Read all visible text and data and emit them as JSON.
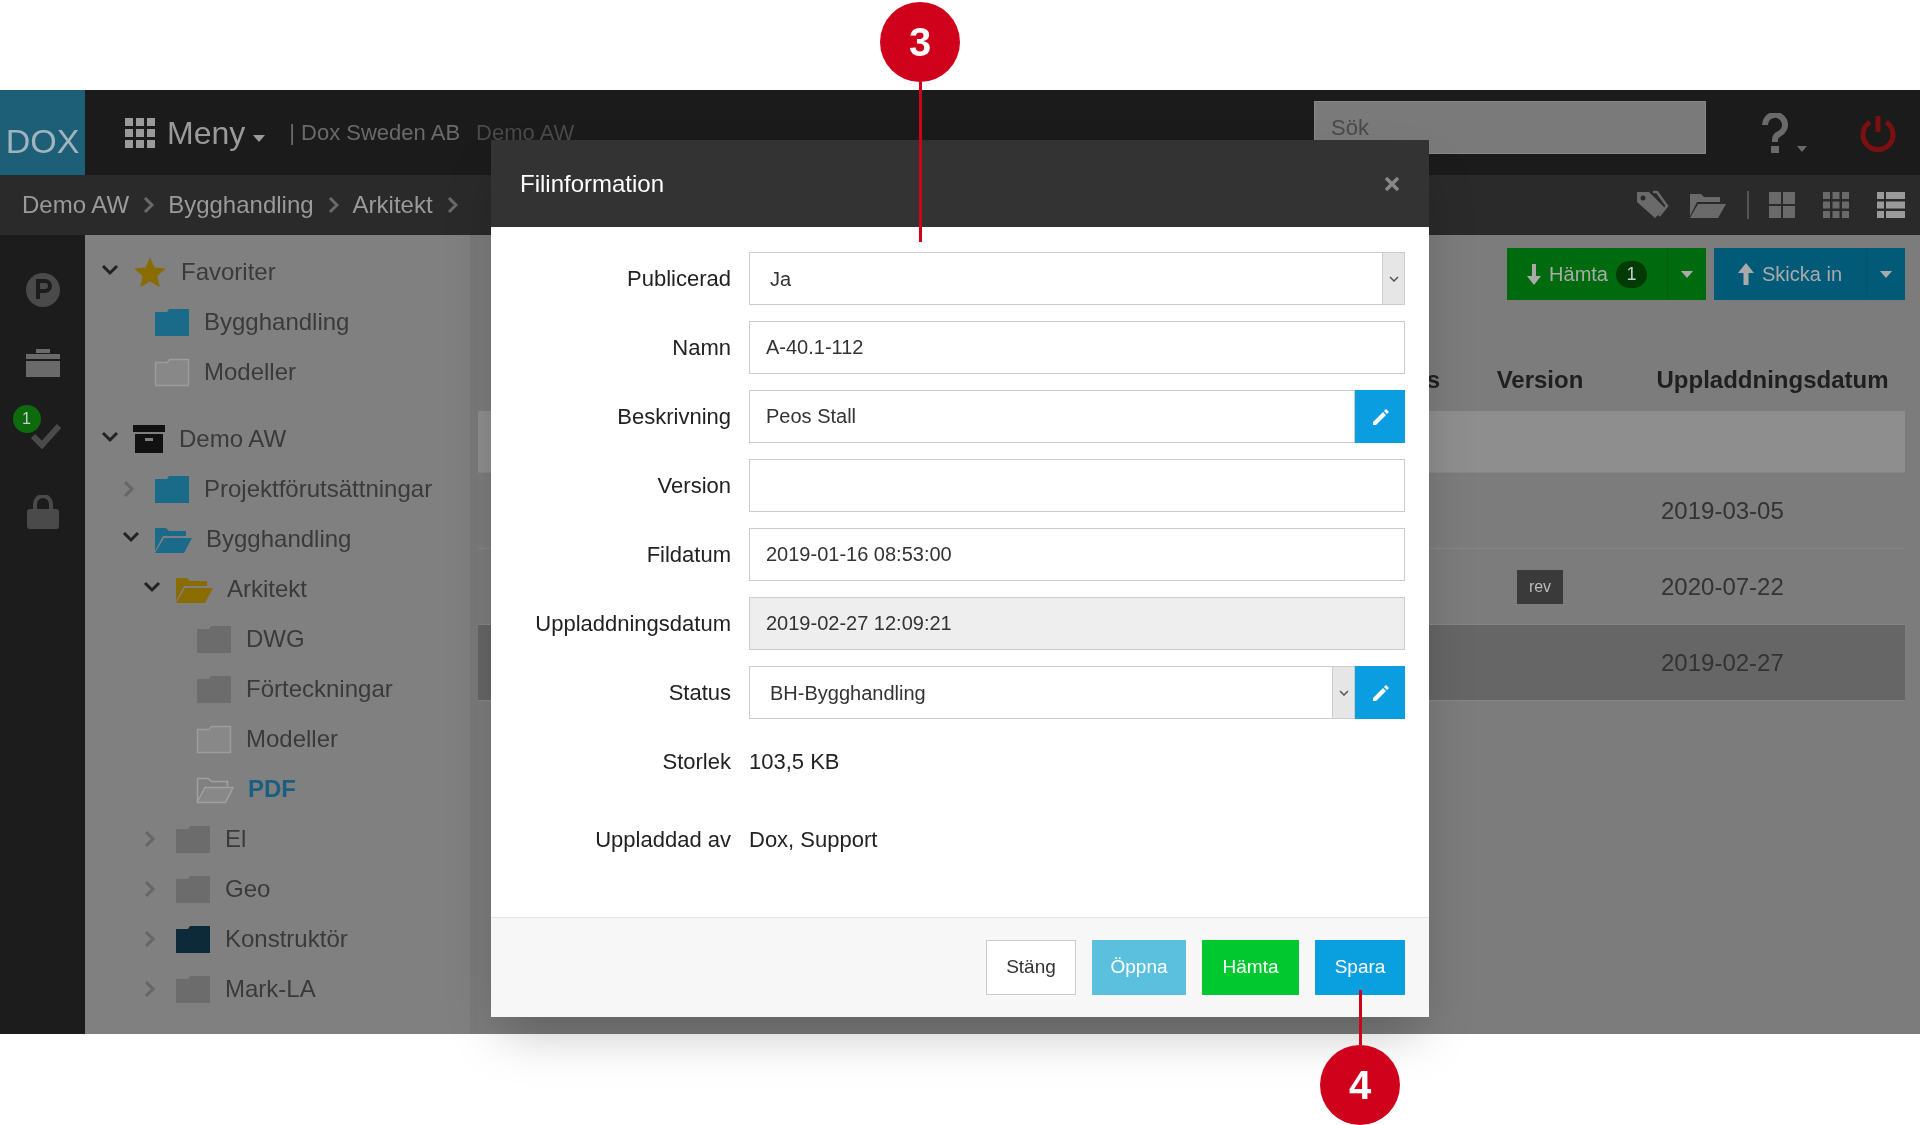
{
  "topbar": {
    "logo": "DOX",
    "menu": "Meny",
    "company": "| Dox Sweden AB",
    "project": "Demo AW",
    "search": {
      "placeholder": "Sök"
    }
  },
  "breadcrumb": [
    "Demo AW",
    "Bygghandling",
    "Arkitekt"
  ],
  "rail": {
    "badge": "1"
  },
  "tree": [
    {
      "label": "Favoriter",
      "kind": "star",
      "expanded": true,
      "selected": false,
      "children": [
        {
          "label": "Bygghandling",
          "kind": "folder",
          "color": "#1a6a8a",
          "selected": false
        },
        {
          "label": "Modeller",
          "kind": "empty",
          "selected": false
        }
      ]
    },
    {
      "label": "Demo AW",
      "kind": "archive",
      "expanded": true,
      "selected": false,
      "children": [
        {
          "label": "Projektförutsättningar",
          "kind": "folder",
          "color": "#1a6a8a",
          "expanded": false,
          "selected": false
        },
        {
          "label": "Bygghandling",
          "kind": "open",
          "color": "#1a6a8a",
          "expanded": true,
          "selected": false,
          "children": [
            {
              "label": "Arkitekt",
              "kind": "open",
              "color": "#8a6d00",
              "expanded": true,
              "selected": false,
              "children": [
                {
                  "label": "DWG",
                  "kind": "folder",
                  "color": "#6c6c6c",
                  "selected": false
                },
                {
                  "label": "Förteckningar",
                  "kind": "folder",
                  "color": "#6c6c6c",
                  "selected": false
                },
                {
                  "label": "Modeller",
                  "kind": "empty",
                  "selected": false
                },
                {
                  "label": "PDF",
                  "kind": "emptyopen",
                  "selected": true
                }
              ]
            },
            {
              "label": "El",
              "kind": "folder",
              "color": "#6c6c6c",
              "expanded": false,
              "selected": false
            },
            {
              "label": "Geo",
              "kind": "folder",
              "color": "#6c6c6c",
              "expanded": false,
              "selected": false
            },
            {
              "label": "Konstruktör",
              "kind": "folder",
              "color": "#0d2a38",
              "expanded": false,
              "selected": false
            },
            {
              "label": "Mark-LA",
              "kind": "folder",
              "color": "#6c6c6c",
              "expanded": false,
              "selected": false
            }
          ]
        }
      ]
    }
  ],
  "toolbar": {
    "download": {
      "label": "Hämta",
      "count": "1"
    },
    "upload": {
      "label": "Skicka in"
    }
  },
  "table": {
    "columns": [
      "s",
      "Version",
      "Uppladdningsdatum"
    ],
    "rows": [
      {
        "hover": true,
        "selected": false
      },
      {
        "hover": false,
        "selected": false,
        "date": "2019-03-05"
      },
      {
        "hover": false,
        "selected": false,
        "badge": "rev",
        "date": "2020-07-22"
      },
      {
        "hover": false,
        "selected": true,
        "date": "2019-02-27"
      }
    ]
  },
  "dialog": {
    "title": "Filinformation",
    "fields": [
      {
        "label": "Publicerad",
        "kind": "select",
        "value": "Ja"
      },
      {
        "label": "Namn",
        "kind": "input",
        "value": "A-40.1-112"
      },
      {
        "label": "Beskrivning",
        "kind": "edit",
        "value": "Peos Stall"
      },
      {
        "label": "Version",
        "kind": "input"
      },
      {
        "label": "Fildatum",
        "kind": "input",
        "value": "2019-01-16 08:53:00"
      },
      {
        "label": "Uppladdningsdatum",
        "kind": "readonly",
        "value": "2019-02-27 12:09:21"
      },
      {
        "label": "Status",
        "kind": "selectedit",
        "value": "BH-Bygghandling"
      },
      {
        "label": "Storlek",
        "kind": "text",
        "value": "103,5 KB"
      },
      {
        "label": "Uppladdad av",
        "kind": "text",
        "value": "Dox, Support"
      }
    ],
    "buttons": [
      {
        "label": "Stäng",
        "kind": "default"
      },
      {
        "label": "Öppna",
        "kind": "info"
      },
      {
        "label": "Hämta",
        "kind": "success"
      },
      {
        "label": "Spara",
        "kind": "primary"
      }
    ]
  },
  "callouts": [
    {
      "label": "3"
    },
    {
      "label": "4"
    }
  ]
}
